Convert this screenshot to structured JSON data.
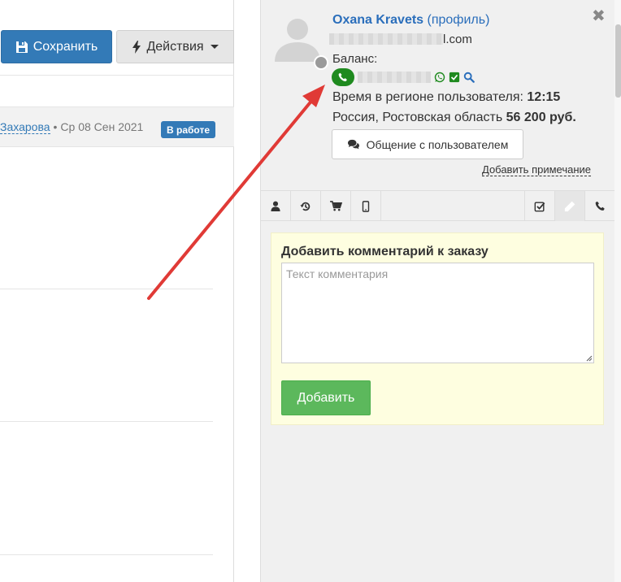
{
  "toolbar": {
    "save_label": "Сохранить",
    "actions_label": "Действия"
  },
  "order": {
    "manager": "Захарова",
    "separator": "•",
    "date": "Ср 08 Сен 2021",
    "status": "В работе"
  },
  "user": {
    "name": "Oxana Kravets",
    "profile_link": "(профиль)",
    "email_suffix": "l.com",
    "balance_label": "Баланс:",
    "time_label": "Время в регионе пользователя:",
    "time_value": "12:15",
    "region": "Россия, Ростовская область",
    "amount": "56 200 руб.",
    "chat_button": "Общение с пользователем",
    "add_note": "Добавить примечание"
  },
  "comment": {
    "title": "Добавить комментарий к заказу",
    "placeholder": "Текст комментария",
    "submit": "Добавить"
  },
  "icons": {
    "save": "floppy-icon",
    "actions": "bolt-icon",
    "phone": "phone-icon",
    "whatsapp": "whatsapp-icon",
    "verified": "check-square-icon",
    "search": "search-icon",
    "chat": "comments-icon",
    "close": "close-icon"
  },
  "colors": {
    "primary": "#337ab7",
    "success": "#5cb85c",
    "phone_green": "#1f8a1f",
    "arrow_red": "#e03a36",
    "comment_bg": "#fefee0"
  }
}
